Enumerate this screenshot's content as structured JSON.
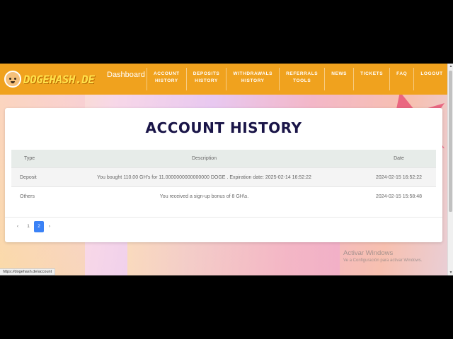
{
  "brand": {
    "name": "DOGEHASH.DE"
  },
  "nav": {
    "dashboard": "Dashboard",
    "items": [
      {
        "line1": "ACCOUNT",
        "line2": "HISTORY"
      },
      {
        "line1": "DEPOSITS",
        "line2": "HISTORY"
      },
      {
        "line1": "WITHDRAWALS",
        "line2": "HISTORY"
      },
      {
        "line1": "REFERRALS",
        "line2": "TOOLS"
      },
      {
        "line1": "NEWS",
        "line2": ""
      },
      {
        "line1": "TICKETS",
        "line2": ""
      },
      {
        "line1": "FAQ",
        "line2": ""
      },
      {
        "line1": "LOGOUT",
        "line2": ""
      }
    ]
  },
  "page": {
    "title": "ACCOUNT HISTORY"
  },
  "table": {
    "headers": {
      "type": "Type",
      "description": "Description",
      "date": "Date"
    },
    "rows": [
      {
        "type": "Deposit",
        "description": "You bought 110.00 GH's for 11.0000000000000000 DOGE . Expiration date: 2025-02-14 16:52:22",
        "date": "2024-02-15 16:52:22"
      },
      {
        "type": "Others",
        "description": "You received a sign-up bonus of 8 GH\\s.",
        "date": "2024-02-15 15:58:48"
      }
    ]
  },
  "pagination": {
    "prev": "‹",
    "pages": [
      "1",
      "2"
    ],
    "active": "2",
    "next": "›"
  },
  "watermark": {
    "title": "Activar Windows",
    "subtitle": "Ve a Configuración para activar Windows."
  },
  "status": {
    "url": "https://dogehash.de/account"
  },
  "colors": {
    "navbar": "#f0a21e",
    "title": "#1a1548",
    "active_page": "#3b82f6"
  }
}
